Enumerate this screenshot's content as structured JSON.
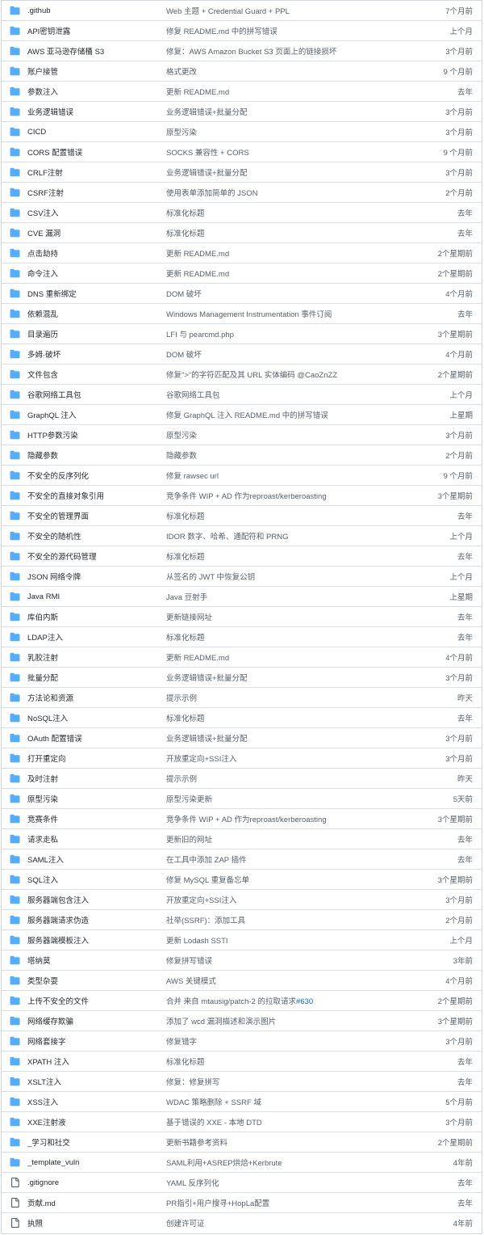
{
  "colors": {
    "folder": "#54aeff",
    "file": "#57606a",
    "text": "#24292f",
    "muted": "#57606a",
    "link": "#0969da",
    "border": "#d0d7de"
  },
  "rows": [
    {
      "type": "dir",
      "name": ".github",
      "message": "Web 主题 + Credential Guard + PPL",
      "time": "7个月前"
    },
    {
      "type": "dir",
      "name": "API密钥泄露",
      "message": "修复 README.md 中的拼写错误",
      "time": "上个月"
    },
    {
      "type": "dir",
      "name": "AWS 亚马逊存储桶 S3",
      "message": "修复：AWS Amazon Bucket S3 页面上的链接损坏",
      "time": "3个月前"
    },
    {
      "type": "dir",
      "name": "账户接管",
      "message": "格式更改",
      "time": "9 个月前"
    },
    {
      "type": "dir",
      "name": "参数注入",
      "message": "更新 README.md",
      "time": "去年"
    },
    {
      "type": "dir",
      "name": "业务逻辑错误",
      "message": "业务逻辑错误+批量分配",
      "time": "3个月前"
    },
    {
      "type": "dir",
      "name": "CICD",
      "message": "原型污染",
      "time": "3个月前"
    },
    {
      "type": "dir",
      "name": "CORS 配置错误",
      "message": "SOCKS 兼容性 + CORS",
      "time": "9 个月前"
    },
    {
      "type": "dir",
      "name": "CRLF注射",
      "message": "业务逻辑错误+批量分配",
      "time": "3个月前"
    },
    {
      "type": "dir",
      "name": "CSRF注射",
      "message": "使用表单添加简单的 JSON",
      "time": "2个月前"
    },
    {
      "type": "dir",
      "name": "CSV注入",
      "message": "标准化标题",
      "time": "去年"
    },
    {
      "type": "dir",
      "name": "CVE 漏洞",
      "message": "标准化标题",
      "time": "去年"
    },
    {
      "type": "dir",
      "name": "点击劫持",
      "message": "更新 README.md",
      "time": "2个星期前"
    },
    {
      "type": "dir",
      "name": "命令注入",
      "message": "更新 README.md",
      "time": "2个星期前"
    },
    {
      "type": "dir",
      "name": "DNS 重新绑定",
      "message": "DOM 破坏",
      "time": "4个月前"
    },
    {
      "type": "dir",
      "name": "依赖混乱",
      "message": "Windows Management Instrumentation 事件订阅",
      "time": "去年"
    },
    {
      "type": "dir",
      "name": "目录遍历",
      "message": "LFI 与 pearcmd.php",
      "time": "3个星期前"
    },
    {
      "type": "dir",
      "name": "多姆·破坏",
      "message": "DOM 破坏",
      "time": "4个月前"
    },
    {
      "type": "dir",
      "name": "文件包含",
      "message": "修复\">\"的字符匹配及其 URL 实体编码 @CaoZnZZ",
      "time": "2个星期前"
    },
    {
      "type": "dir",
      "name": "谷歌网络工具包",
      "message": "谷歌网络工具包",
      "time": "上个月"
    },
    {
      "type": "dir",
      "name": "GraphQL 注入",
      "message": "修复 GraphQL 注入 README.md 中的拼写错误",
      "time": "上星期"
    },
    {
      "type": "dir",
      "name": "HTTP参数污染",
      "message": "原型污染",
      "time": "3个月前"
    },
    {
      "type": "dir",
      "name": "隐藏参数",
      "message": "隐藏参数",
      "time": "2个月前"
    },
    {
      "type": "dir",
      "name": "不安全的反序列化",
      "message": "修复 rawsec url",
      "time": "9 个月前"
    },
    {
      "type": "dir",
      "name": "不安全的直接对象引用",
      "message": "竞争条件 WIP + AD 作为reproast/kerberoasting",
      "time": "3个星期前"
    },
    {
      "type": "dir",
      "name": "不安全的管理界面",
      "message": "标准化标题",
      "time": "去年"
    },
    {
      "type": "dir",
      "name": "不安全的随机性",
      "message": "IDOR 数字、哈希、通配符和 PRNG",
      "time": "上个月"
    },
    {
      "type": "dir",
      "name": "不安全的源代码管理",
      "message": "标准化标题",
      "time": "去年"
    },
    {
      "type": "dir",
      "name": "JSON 网络令牌",
      "message": "从签名的 JWT 中恢复公钥",
      "time": "上个月"
    },
    {
      "type": "dir",
      "name": "Java RMI",
      "message": "Java 豆射手",
      "time": "上星期"
    },
    {
      "type": "dir",
      "name": "库伯内斯",
      "message": "更新链接网址",
      "time": "去年"
    },
    {
      "type": "dir",
      "name": "LDAP注入",
      "message": "标准化标题",
      "time": "去年"
    },
    {
      "type": "dir",
      "name": "乳胶注射",
      "message": "更新 README.md",
      "time": "4个月前"
    },
    {
      "type": "dir",
      "name": "批量分配",
      "message": "业务逻辑错误+批量分配",
      "time": "3个月前"
    },
    {
      "type": "dir",
      "name": "方法论和资源",
      "message": "提示示例",
      "time": "昨天"
    },
    {
      "type": "dir",
      "name": "NoSQL注入",
      "message": "标准化标题",
      "time": "去年"
    },
    {
      "type": "dir",
      "name": "OAuth 配置错误",
      "message": "业务逻辑错误+批量分配",
      "time": "3个月前"
    },
    {
      "type": "dir",
      "name": "打开重定向",
      "message": "开放重定向+SSI注入",
      "time": "3个月前"
    },
    {
      "type": "dir",
      "name": "及时注射",
      "message": "提示示例",
      "time": "昨天"
    },
    {
      "type": "dir",
      "name": "原型污染",
      "message": "原型污染更新",
      "time": "5天前"
    },
    {
      "type": "dir",
      "name": "竞赛条件",
      "message": "竞争条件 WIP + AD 作为reproast/kerberoasting",
      "time": "3个星期前"
    },
    {
      "type": "dir",
      "name": "请求走私",
      "message": "更新旧的网址",
      "time": "去年"
    },
    {
      "type": "dir",
      "name": "SAML注入",
      "message": "在工具中添加 ZAP 插件",
      "time": "去年"
    },
    {
      "type": "dir",
      "name": "SQL注入",
      "message": "修复 MySQL 重复备忘单",
      "time": "3个星期前"
    },
    {
      "type": "dir",
      "name": "服务器端包含注入",
      "message": "开放重定向+SSI注入",
      "time": "3个月前"
    },
    {
      "type": "dir",
      "name": "服务器端请求伪造",
      "message": "社举(SSRF)：添加工具",
      "time": "2个月前"
    },
    {
      "type": "dir",
      "name": "服务器端模板注入",
      "message": "更新 Lodash SSTI",
      "time": "上个月"
    },
    {
      "type": "dir",
      "name": "塔纳莫",
      "message": "修复拼写错误",
      "time": "3年前"
    },
    {
      "type": "dir",
      "name": "类型杂耍",
      "message": "AWS 关键模式",
      "time": "4个月前"
    },
    {
      "type": "dir",
      "name": "上传不安全的文件",
      "message": "合并 来自 mtausig/patch-2 的拉取请求",
      "pr": "#630",
      "time": "2个星期前"
    },
    {
      "type": "dir",
      "name": "网络缓存欺骗",
      "message": "添加了 wcd 漏洞描述和演示图片",
      "time": "3个星期前"
    },
    {
      "type": "dir",
      "name": "网络套接字",
      "message": "修复错字",
      "time": "3个月前"
    },
    {
      "type": "dir",
      "name": "XPATH 注入",
      "message": "标准化标题",
      "time": "去年"
    },
    {
      "type": "dir",
      "name": "XSLT注入",
      "message": "修复：修复拼写",
      "time": "去年"
    },
    {
      "type": "dir",
      "name": "XSS注入",
      "message": "WDAC 策略删除 + SSRF 域",
      "time": "5个月前"
    },
    {
      "type": "dir",
      "name": "XXE注射液",
      "message": "基于错误的 XXE - 本地 DTD",
      "time": "3个月前"
    },
    {
      "type": "dir",
      "name": "_学习和社交",
      "message": "更新书籍参考资料",
      "time": "2个星期前"
    },
    {
      "type": "dir",
      "name": "_template_vuln",
      "message": "SAML利用+ASREP烘焙+Kerbrute",
      "time": "4年前"
    },
    {
      "type": "file",
      "name": ".gitignore",
      "message": "YAML 反序列化",
      "time": "去年"
    },
    {
      "type": "file",
      "name": "贡献.md",
      "message": "PR指引+用户搜寻+HopLa配置",
      "time": "去年"
    },
    {
      "type": "file",
      "name": "执照",
      "message": "创建许可证",
      "time": "4年前"
    }
  ]
}
